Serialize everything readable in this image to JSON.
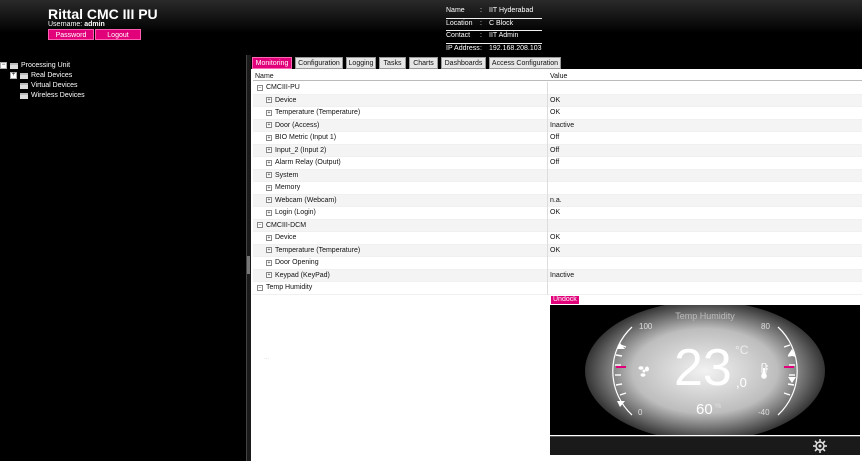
{
  "header": {
    "title": "Rittal CMC III PU",
    "username_label": "Username:",
    "username": "admin",
    "password_button": "Password",
    "logout_button": "Logout",
    "info": [
      {
        "key": "Name",
        "value": "IIT Hyderabad"
      },
      {
        "key": "Location",
        "value": "C Block"
      },
      {
        "key": "Contact",
        "value": "IIT Admin"
      },
      {
        "key": "IP Address",
        "value": "192.168.208.103"
      }
    ],
    "separator": ":"
  },
  "tree": {
    "root": "Processing Unit",
    "children": [
      "Real Devices",
      "Virtual Devices",
      "Wireless Devices"
    ]
  },
  "tabs": [
    "Monitoring",
    "Configuration",
    "Logging",
    "Tasks",
    "Charts",
    "Dashboards",
    "Access Configuration"
  ],
  "active_tab": "Monitoring",
  "table": {
    "headers": {
      "name": "Name",
      "value": "Value"
    },
    "rows": [
      {
        "name": "CMCIII-PU",
        "value": "",
        "level": 0,
        "expander": "−"
      },
      {
        "name": "Device",
        "value": "OK",
        "level": 1,
        "expander": "+"
      },
      {
        "name": "Temperature (Temperature)",
        "value": "OK",
        "level": 1,
        "expander": "+"
      },
      {
        "name": "Door (Access)",
        "value": "Inactive",
        "level": 1,
        "expander": "+"
      },
      {
        "name": "BIO Metric (Input 1)",
        "value": "Off",
        "level": 1,
        "expander": "+"
      },
      {
        "name": "Input_2 (Input 2)",
        "value": "Off",
        "level": 1,
        "expander": "+"
      },
      {
        "name": "Alarm Relay (Output)",
        "value": "Off",
        "level": 1,
        "expander": "+"
      },
      {
        "name": "System",
        "value": "",
        "level": 1,
        "expander": "+"
      },
      {
        "name": "Memory",
        "value": "",
        "level": 1,
        "expander": "+"
      },
      {
        "name": "Webcam (Webcam)",
        "value": "n.a.",
        "level": 1,
        "expander": "+"
      },
      {
        "name": "Login (Login)",
        "value": "OK",
        "level": 1,
        "expander": "+"
      },
      {
        "name": "CMCIII-DCM",
        "value": "",
        "level": 0,
        "expander": "−"
      },
      {
        "name": "Device",
        "value": "OK",
        "level": 1,
        "expander": "+"
      },
      {
        "name": "Temperature (Temperature)",
        "value": "OK",
        "level": 1,
        "expander": "+"
      },
      {
        "name": "Door Opening",
        "value": "",
        "level": 1,
        "expander": "+"
      },
      {
        "name": "Keypad (KeyPad)",
        "value": "Inactive",
        "level": 1,
        "expander": "+"
      },
      {
        "name": "Temp Humidity",
        "value": "",
        "level": 0,
        "expander": "−"
      }
    ]
  },
  "widget": {
    "unlock_button": "Undock",
    "title": "Temp Humidity",
    "temperature_int": "23",
    "temperature_dec": ",0",
    "temperature_unit": "°C",
    "humidity": "60",
    "humidity_unit": "%",
    "left_scale_top": "100",
    "left_scale_bottom": "0",
    "right_scale_top": "80",
    "right_scale_bottom": "-40",
    "dots": "...",
    "icons": [
      "fan-icon",
      "thermometer-icon",
      "settings-gear-icon"
    ],
    "accent": "#e2007a"
  }
}
